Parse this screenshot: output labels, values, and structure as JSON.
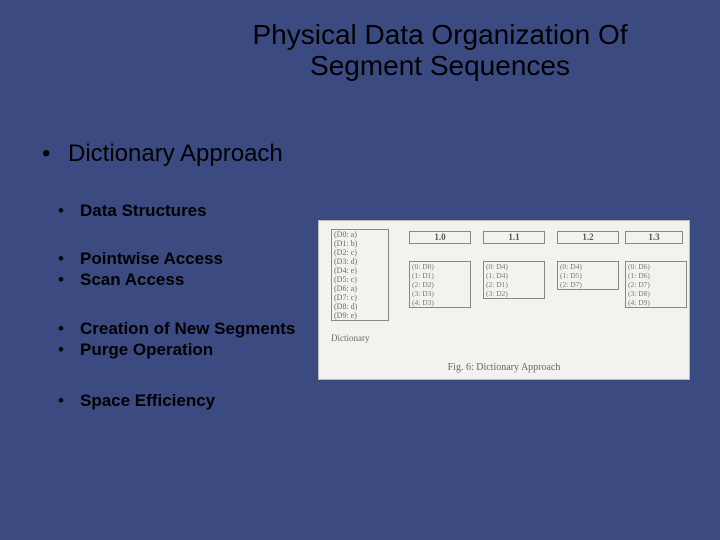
{
  "title_line1": "Physical Data Organization Of",
  "title_line2": "Segment Sequences",
  "bullets": {
    "top": "Dictionary Approach",
    "data_structures": "Data Structures",
    "pointwise": "Pointwise Access",
    "scan": "Scan Access",
    "creation": "Creation of New Segments",
    "purge": "Purge Operation",
    "space": "Space Efficiency"
  },
  "figure": {
    "dictionary_label": "Dictionary",
    "caption": "Fig. 6: Dictionary Approach",
    "dictionary_entries": [
      "(D0: a)",
      "(D1: b)",
      "(D2: c)",
      "(D3: d)",
      "(D4: e)",
      "(D5: c)",
      "(D6: a)",
      "(D7: c)",
      "(D8: d)",
      "(D9: e)"
    ],
    "time_headers": [
      "1.0",
      "1.1",
      "1.2",
      "1.3"
    ],
    "columns": {
      "c0": [
        "(0: D0)",
        "(1: D1)",
        "(2: D2)",
        "(3: D3)",
        "(4: D3)"
      ],
      "c1": [
        "(0: D4)",
        "(1: D4)",
        "(2: D1)",
        "(3: D2)"
      ],
      "c2": [
        "(0: D4)",
        "(1: D5)",
        "(2: D7)"
      ],
      "c3": [
        "(0: D6)",
        "(1: D6)",
        "(2: D7)",
        "(3: D8)",
        "(4: D9)"
      ]
    }
  }
}
